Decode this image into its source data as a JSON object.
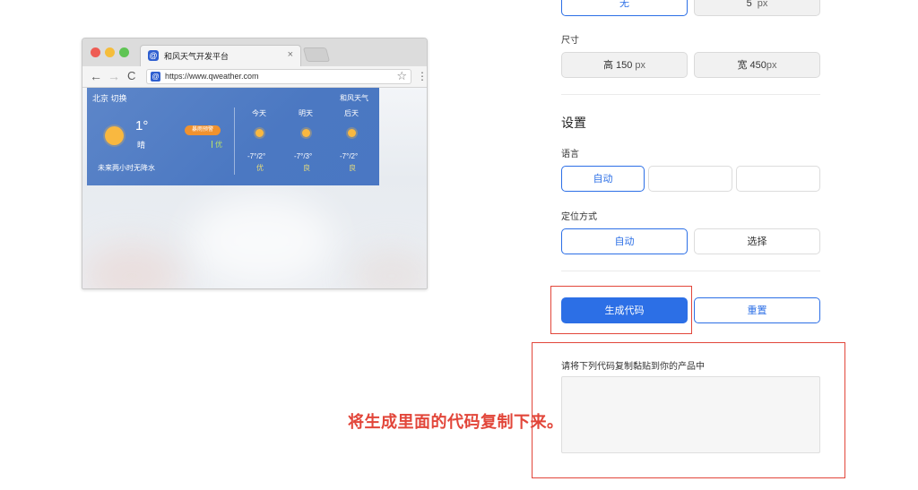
{
  "browser": {
    "tab_title": "和风天气开发平台",
    "tab_close": "×",
    "tab_icon": "@",
    "url": "https://www.qweather.com",
    "nav_back": "←",
    "nav_forward": "→",
    "nav_reload": "C",
    "star": "☆",
    "menu": "⋮"
  },
  "widget": {
    "city": "北京 切换",
    "brand": "和风天气",
    "temperature": "1°",
    "condition": "晴",
    "alert": "暴雨预警",
    "aqi": "优",
    "rain": "未来两小时无降水",
    "forecast": [
      {
        "day": "今天",
        "temp": "-7°/2°",
        "aqi": "优"
      },
      {
        "day": "明天",
        "temp": "-7°/3°",
        "aqi": "良"
      },
      {
        "day": "后天",
        "temp": "-7°/2°",
        "aqi": "良"
      }
    ]
  },
  "settings": {
    "border_options": {
      "none": "无",
      "width_value": "5",
      "width_unit": "px"
    },
    "size_label": "尺寸",
    "height": {
      "prefix": "高",
      "value": "150",
      "unit": "px"
    },
    "width": {
      "prefix": "宽",
      "value": "450",
      "unit": "px"
    },
    "settings_title": "设置",
    "language_label": "语言",
    "language_options": [
      "自动",
      "",
      ""
    ],
    "location_label": "定位方式",
    "location_options": [
      "自动",
      "选择"
    ],
    "generate_button": "生成代码",
    "reset_button": "重置",
    "copy_instruction": "请将下列代码复制黏贴到你的产品中",
    "code_value": ""
  },
  "annotation": {
    "text": "将生成里面的代码复制下来。",
    "color": "#e2463a"
  },
  "colors": {
    "primary": "#2c6fe6",
    "widget_blue": "#4b78c2",
    "sun": "#f9b840",
    "alert_orange": "#f0922f"
  }
}
